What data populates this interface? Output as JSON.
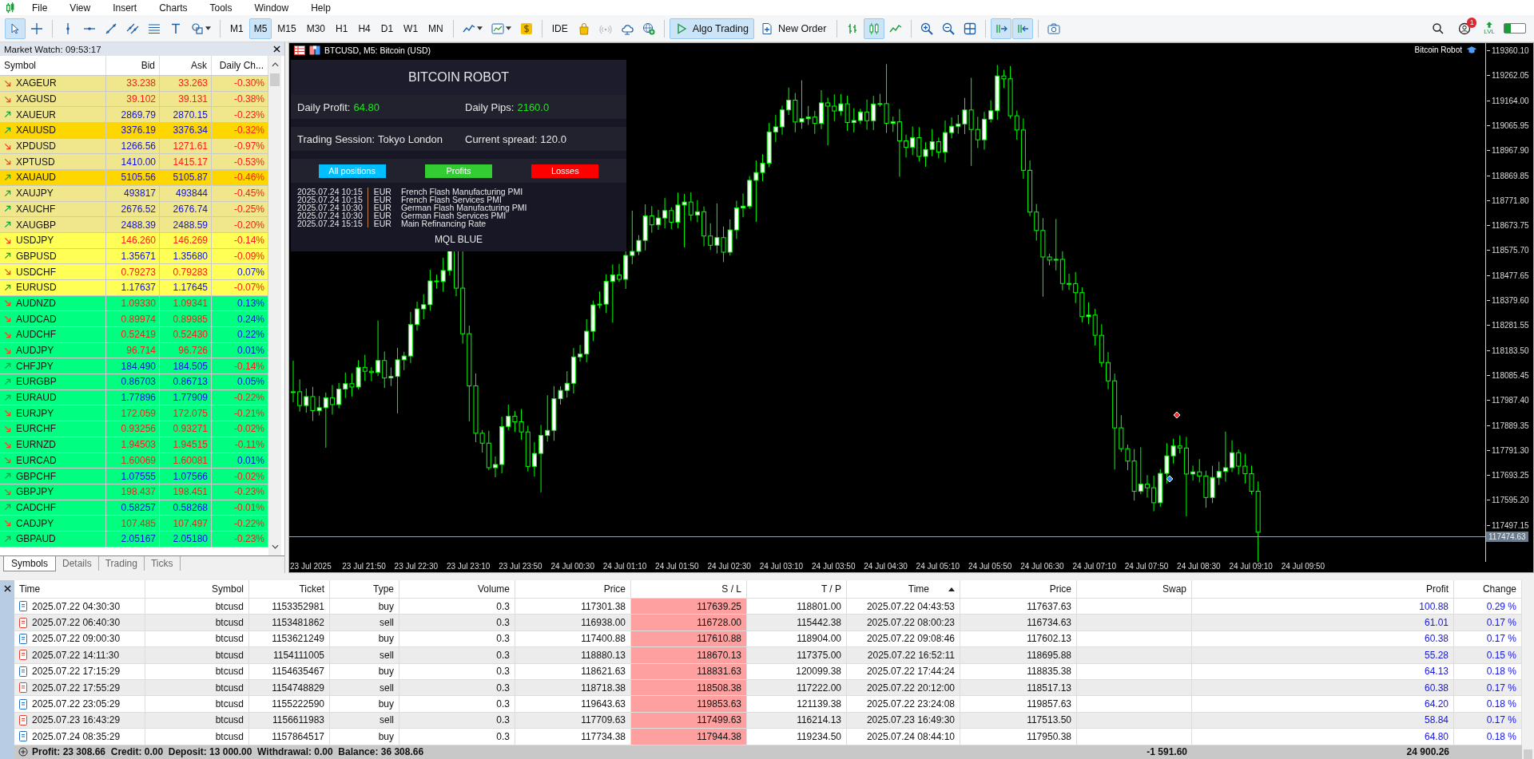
{
  "menu": [
    "File",
    "View",
    "Insert",
    "Charts",
    "Tools",
    "Window",
    "Help"
  ],
  "toolbar": {
    "groups": [
      [
        {
          "kind": "cursor",
          "selected": true
        },
        {
          "kind": "crosshair",
          "selected": false
        }
      ],
      [
        {
          "kind": "vline"
        },
        {
          "kind": "hline"
        },
        {
          "kind": "trendline"
        },
        {
          "kind": "channel"
        },
        {
          "kind": "fibo"
        },
        {
          "kind": "text"
        },
        {
          "kind": "shapes"
        }
      ],
      [
        {
          "kind": "timeframe",
          "label": "M1",
          "selected": false
        },
        {
          "kind": "timeframe",
          "label": "M5",
          "selected": true
        },
        {
          "kind": "timeframe",
          "label": "M15",
          "selected": false
        },
        {
          "kind": "timeframe",
          "label": "M30",
          "selected": false
        },
        {
          "kind": "timeframe",
          "label": "H1",
          "selected": false
        },
        {
          "kind": "timeframe",
          "label": "H4",
          "selected": false
        },
        {
          "kind": "timeframe",
          "label": "D1",
          "selected": false
        },
        {
          "kind": "timeframe",
          "label": "W1",
          "selected": false
        },
        {
          "kind": "timeframe",
          "label": "MN",
          "selected": false
        }
      ],
      [
        {
          "kind": "linechart"
        },
        {
          "kind": "indicators"
        },
        {
          "kind": "dollar"
        }
      ],
      [
        {
          "kind": "label",
          "label": "IDE"
        },
        {
          "kind": "bag"
        },
        {
          "kind": "signal"
        },
        {
          "kind": "cloud"
        },
        {
          "kind": "globe"
        }
      ],
      [
        {
          "kind": "algo",
          "label": "Algo Trading",
          "selected": true
        },
        {
          "kind": "neworder",
          "label": "New Order",
          "selected": false
        }
      ],
      [
        {
          "kind": "bars",
          "selected": false
        },
        {
          "kind": "candles",
          "selected": true
        },
        {
          "kind": "line",
          "selected": false
        }
      ],
      [
        {
          "kind": "zoomin"
        },
        {
          "kind": "zoomout"
        },
        {
          "kind": "grid"
        }
      ],
      [
        {
          "kind": "shift",
          "selected": true
        },
        {
          "kind": "autoscroll",
          "selected": true
        }
      ],
      [
        {
          "kind": "camera"
        }
      ]
    ],
    "notification_badge": "1",
    "level_label": "LVL"
  },
  "market_watch": {
    "title": "Market Watch: 09:53:17",
    "columns": [
      "Symbol",
      "Bid",
      "Ask",
      "Daily Ch..."
    ],
    "rows": [
      {
        "symbol": "XAGEUR",
        "rising": false,
        "bid": "33.238",
        "bid_up": false,
        "ask": "33.263",
        "change": "-0.30%",
        "change_up": false,
        "color": "#f0e68c"
      },
      {
        "symbol": "XAGUSD",
        "rising": false,
        "bid": "39.102",
        "bid_up": false,
        "ask": "39.131",
        "change": "-0.38%",
        "change_up": false,
        "color": "#f0e68c"
      },
      {
        "symbol": "XAUEUR",
        "rising": true,
        "bid": "2869.79",
        "bid_up": true,
        "ask": "2870.15",
        "change": "-0.23%",
        "change_up": false,
        "color": "#f0e68c"
      },
      {
        "symbol": "XAUUSD",
        "rising": true,
        "bid": "3376.19",
        "bid_up": true,
        "ask": "3376.34",
        "change": "-0.32%",
        "change_up": false,
        "color": "#ffd700"
      },
      {
        "symbol": "XPDUSD",
        "rising": false,
        "bid": "1266.56",
        "bid_up": true,
        "ask": "1271.61",
        "change": "-0.97%",
        "change_up": false,
        "color": "#f0e68c"
      },
      {
        "symbol": "XPTUSD",
        "rising": false,
        "bid": "1410.00",
        "bid_up": true,
        "ask": "1415.17",
        "change": "-0.53%",
        "change_up": false,
        "color": "#f0e68c"
      },
      {
        "symbol": "XAUAUD",
        "rising": true,
        "bid": "5105.56",
        "bid_up": true,
        "ask": "5105.87",
        "change": "-0.46%",
        "change_up": false,
        "color": "#ffd700"
      },
      {
        "symbol": "XAUJPY",
        "rising": true,
        "bid": "493817",
        "bid_up": true,
        "ask": "493844",
        "change": "-0.45%",
        "change_up": false,
        "color": "#f0e68c"
      },
      {
        "symbol": "XAUCHF",
        "rising": true,
        "bid": "2676.52",
        "bid_up": true,
        "ask": "2676.74",
        "change": "-0.25%",
        "change_up": false,
        "color": "#f0e68c"
      },
      {
        "symbol": "XAUGBP",
        "rising": true,
        "bid": "2488.39",
        "bid_up": true,
        "ask": "2488.59",
        "change": "-0.20%",
        "change_up": false,
        "color": "#f0e68c"
      },
      {
        "symbol": "USDJPY",
        "rising": false,
        "bid": "146.260",
        "bid_up": false,
        "ask": "146.269",
        "change": "-0.14%",
        "change_up": false,
        "color": "#ffff55"
      },
      {
        "symbol": "GBPUSD",
        "rising": true,
        "bid": "1.35671",
        "bid_up": true,
        "ask": "1.35680",
        "change": "-0.09%",
        "change_up": false,
        "color": "#ffff55"
      },
      {
        "symbol": "USDCHF",
        "rising": false,
        "bid": "0.79273",
        "bid_up": false,
        "ask": "0.79283",
        "change": "0.07%",
        "change_up": true,
        "color": "#ffff55"
      },
      {
        "symbol": "EURUSD",
        "rising": true,
        "bid": "1.17637",
        "bid_up": true,
        "ask": "1.17645",
        "change": "-0.07%",
        "change_up": false,
        "color": "#ffff55"
      },
      {
        "symbol": "AUDNZD",
        "rising": false,
        "bid": "1.09330",
        "bid_up": false,
        "ask": "1.09341",
        "change": "0.13%",
        "change_up": true,
        "color": "#00ff80"
      },
      {
        "symbol": "AUDCAD",
        "rising": false,
        "bid": "0.89974",
        "bid_up": false,
        "ask": "0.89985",
        "change": "0.24%",
        "change_up": true,
        "color": "#00ff80"
      },
      {
        "symbol": "AUDCHF",
        "rising": false,
        "bid": "0.52419",
        "bid_up": false,
        "ask": "0.52430",
        "change": "0.22%",
        "change_up": true,
        "color": "#00ff80"
      },
      {
        "symbol": "AUDJPY",
        "rising": false,
        "bid": "96.714",
        "bid_up": false,
        "ask": "96.726",
        "change": "0.01%",
        "change_up": true,
        "color": "#00ff80"
      },
      {
        "symbol": "CHFJPY",
        "rising": true,
        "bid": "184.490",
        "bid_up": true,
        "ask": "184.505",
        "change": "-0.14%",
        "change_up": false,
        "color": "#00ff80"
      },
      {
        "symbol": "EURGBP",
        "rising": true,
        "bid": "0.86703",
        "bid_up": true,
        "ask": "0.86713",
        "change": "0.05%",
        "change_up": true,
        "color": "#00ff80"
      },
      {
        "symbol": "EURAUD",
        "rising": true,
        "bid": "1.77896",
        "bid_up": true,
        "ask": "1.77909",
        "change": "-0.22%",
        "change_up": false,
        "color": "#00ff80"
      },
      {
        "symbol": "EURJPY",
        "rising": false,
        "bid": "172.059",
        "bid_up": false,
        "ask": "172.075",
        "change": "-0.21%",
        "change_up": false,
        "color": "#00ff80"
      },
      {
        "symbol": "EURCHF",
        "rising": false,
        "bid": "0.93256",
        "bid_up": false,
        "ask": "0.93271",
        "change": "-0.02%",
        "change_up": false,
        "color": "#00ff80"
      },
      {
        "symbol": "EURNZD",
        "rising": false,
        "bid": "1.94503",
        "bid_up": false,
        "ask": "1.94515",
        "change": "-0.11%",
        "change_up": false,
        "color": "#00ff80"
      },
      {
        "symbol": "EURCAD",
        "rising": false,
        "bid": "1.60069",
        "bid_up": false,
        "ask": "1.60081",
        "change": "0.01%",
        "change_up": true,
        "color": "#00ff80"
      },
      {
        "symbol": "GBPCHF",
        "rising": true,
        "bid": "1.07555",
        "bid_up": true,
        "ask": "1.07566",
        "change": "-0.02%",
        "change_up": false,
        "color": "#00ff80"
      },
      {
        "symbol": "GBPJPY",
        "rising": false,
        "bid": "198.437",
        "bid_up": false,
        "ask": "198.451",
        "change": "-0.23%",
        "change_up": false,
        "color": "#00ff80"
      },
      {
        "symbol": "CADCHF",
        "rising": true,
        "bid": "0.58257",
        "bid_up": true,
        "ask": "0.58268",
        "change": "-0.01%",
        "change_up": false,
        "color": "#00ff80"
      },
      {
        "symbol": "CADJPY",
        "rising": false,
        "bid": "107.485",
        "bid_up": false,
        "ask": "107.497",
        "change": "-0.22%",
        "change_up": false,
        "color": "#00ff80"
      },
      {
        "symbol": "GBPAUD",
        "rising": true,
        "bid": "2.05167",
        "bid_up": true,
        "ask": "2.05180",
        "change": "-0.23%",
        "change_up": false,
        "color": "#00ff80"
      }
    ],
    "tabs": [
      {
        "label": "Symbols",
        "selected": true
      },
      {
        "label": "Details",
        "selected": false
      },
      {
        "label": "Trading",
        "selected": false
      },
      {
        "label": "Ticks",
        "selected": false
      }
    ]
  },
  "chart": {
    "title": "BTCUSD, M5:  Bitcoin (USD)",
    "expert": "Bitcoin Robot",
    "price_axis": [
      "119360.10",
      "119262.05",
      "119164.00",
      "119065.95",
      "118967.90",
      "118869.85",
      "118771.80",
      "118673.75",
      "118575.70",
      "118477.65",
      "118379.60",
      "118281.55",
      "118183.50",
      "118085.45",
      "117987.40",
      "117889.35",
      "117791.30",
      "117693.25",
      "117595.20",
      "117497.15"
    ],
    "current_price": "117474.63",
    "time_axis": [
      "23 Jul 2025",
      "23 Jul 21:50",
      "23 Jul 22:30",
      "23 Jul 23:10",
      "23 Jul 23:50",
      "24 Jul 00:30",
      "24 Jul 01:10",
      "24 Jul 01:50",
      "24 Jul 02:30",
      "24 Jul 03:10",
      "24 Jul 03:50",
      "24 Jul 04:30",
      "24 Jul 05:10",
      "24 Jul 05:50",
      "24 Jul 06:30",
      "24 Jul 07:10",
      "24 Jul 07:50",
      "24 Jul 08:30",
      "24 Jul 09:10",
      "24 Jul 09:50"
    ],
    "panel": {
      "title": "BITCOIN ROBOT",
      "stats": [
        [
          {
            "label": "Daily Profit:",
            "value": "64.80",
            "highlight": true
          },
          {
            "label": "Daily Pips:",
            "value": "2160.0",
            "highlight": true
          }
        ],
        [
          {
            "label": "Trading Session:",
            "value": "Tokyo London",
            "highlight": false
          },
          {
            "label": "Current spread:",
            "value": "120.0",
            "highlight": false
          }
        ]
      ],
      "buttons": [
        {
          "label": "All positions",
          "color": "#00bfff"
        },
        {
          "label": "Profits",
          "color": "#33cc33"
        },
        {
          "label": "Losses",
          "color": "#ff0000"
        }
      ],
      "news": [
        {
          "date": "2025.07.24 10:15",
          "currency": "EUR",
          "event": "French Flash Manufacturing PMI"
        },
        {
          "date": "2025.07.24 10:15",
          "currency": "EUR",
          "event": "French Flash Services PMI"
        },
        {
          "date": "2025.07.24 10:30",
          "currency": "EUR",
          "event": "German Flash Manufacturing PMI"
        },
        {
          "date": "2025.07.24 10:30",
          "currency": "EUR",
          "event": "German Flash Services PMI"
        },
        {
          "date": "2025.07.24 15:15",
          "currency": "EUR",
          "event": "Main Refinancing Rate"
        }
      ],
      "footer": "MQL BLUE"
    }
  },
  "toolbox": {
    "columns": [
      {
        "label": "Time",
        "sorted": false
      },
      {
        "label": "Symbol",
        "sorted": false
      },
      {
        "label": "Ticket",
        "sorted": false
      },
      {
        "label": "Type",
        "sorted": false
      },
      {
        "label": "Volume",
        "sorted": false
      },
      {
        "label": "Price",
        "sorted": false
      },
      {
        "label": "S / L",
        "sorted": false
      },
      {
        "label": "T / P",
        "sorted": false
      },
      {
        "label": "Time",
        "sorted": true
      },
      {
        "label": "Price",
        "sorted": false
      },
      {
        "label": "Swap",
        "sorted": false
      },
      {
        "label": "Profit",
        "sorted": false
      },
      {
        "label": "Change",
        "sorted": false
      }
    ],
    "rows": [
      {
        "kind": "buy",
        "time": "2025.07.22 04:30:30",
        "symbol": "btcusd",
        "ticket": "1153352981",
        "type": "buy",
        "volume": "0.3",
        "price": "117301.38",
        "sl": "117639.25",
        "sl_alert": true,
        "tp": "118801.00",
        "close_time": "2025.07.22 04:43:53",
        "close_price": "117637.63",
        "profit": "100.88",
        "change": "0.29 %"
      },
      {
        "kind": "sell",
        "time": "2025.07.22 06:40:30",
        "symbol": "btcusd",
        "ticket": "1153481862",
        "type": "sell",
        "volume": "0.3",
        "price": "116938.00",
        "sl": "116728.00",
        "sl_alert": true,
        "tp": "115442.38",
        "close_time": "2025.07.22 08:00:23",
        "close_price": "116734.63",
        "profit": "61.01",
        "change": "0.17 %"
      },
      {
        "kind": "buy",
        "time": "2025.07.22 09:00:30",
        "symbol": "btcusd",
        "ticket": "1153621249",
        "type": "buy",
        "volume": "0.3",
        "price": "117400.88",
        "sl": "117610.88",
        "sl_alert": true,
        "tp": "118904.00",
        "close_time": "2025.07.22 09:08:46",
        "close_price": "117602.13",
        "profit": "60.38",
        "change": "0.17 %"
      },
      {
        "kind": "sell",
        "time": "2025.07.22 14:11:30",
        "symbol": "btcusd",
        "ticket": "1154111005",
        "type": "sell",
        "volume": "0.3",
        "price": "118880.13",
        "sl": "118670.13",
        "sl_alert": true,
        "tp": "117375.00",
        "close_time": "2025.07.22 16:52:11",
        "close_price": "118695.88",
        "profit": "55.28",
        "change": "0.15 %"
      },
      {
        "kind": "buy",
        "time": "2025.07.22 17:15:29",
        "symbol": "btcusd",
        "ticket": "1154635467",
        "type": "buy",
        "volume": "0.3",
        "price": "118621.63",
        "sl": "118831.63",
        "sl_alert": true,
        "tp": "120099.38",
        "close_time": "2025.07.22 17:44:24",
        "close_price": "118835.38",
        "profit": "64.13",
        "change": "0.18 %"
      },
      {
        "kind": "sell",
        "time": "2025.07.22 17:55:29",
        "symbol": "btcusd",
        "ticket": "1154748829",
        "type": "sell",
        "volume": "0.3",
        "price": "118718.38",
        "sl": "118508.38",
        "sl_alert": true,
        "tp": "117222.00",
        "close_time": "2025.07.22 20:12:00",
        "close_price": "118517.13",
        "profit": "60.38",
        "change": "0.17 %"
      },
      {
        "kind": "buy",
        "time": "2025.07.22 23:05:29",
        "symbol": "btcusd",
        "ticket": "1155222590",
        "type": "buy",
        "volume": "0.3",
        "price": "119643.63",
        "sl": "119853.63",
        "sl_alert": true,
        "tp": "121139.38",
        "close_time": "2025.07.22 23:24:08",
        "close_price": "119857.63",
        "profit": "64.20",
        "change": "0.18 %"
      },
      {
        "kind": "sell",
        "time": "2025.07.23 16:43:29",
        "symbol": "btcusd",
        "ticket": "1156611983",
        "type": "sell",
        "volume": "0.3",
        "price": "117709.63",
        "sl": "117499.63",
        "sl_alert": true,
        "tp": "116214.13",
        "close_time": "2025.07.23 16:49:30",
        "close_price": "117513.50",
        "profit": "58.84",
        "change": "0.17 %"
      },
      {
        "kind": "buy",
        "time": "2025.07.24 08:35:29",
        "symbol": "btcusd",
        "ticket": "1157864517",
        "type": "buy",
        "volume": "0.3",
        "price": "117734.38",
        "sl": "117944.38",
        "sl_alert": true,
        "tp": "119234.50",
        "close_time": "2025.07.24 08:44:10",
        "close_price": "117950.38",
        "profit": "64.80",
        "change": "0.18 %"
      }
    ],
    "summary": "Profit: 23 308.66  Credit: 0.00  Deposit: 13 000.00  Withdrawal: 0.00  Balance: 36 308.66",
    "swap_total": "-1 591.60",
    "profit_total": "24 900.26"
  }
}
